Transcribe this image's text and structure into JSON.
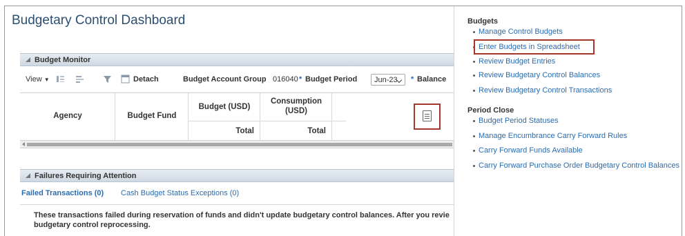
{
  "page": {
    "title": "Budgetary Control Dashboard"
  },
  "budget_monitor": {
    "header": "Budget Monitor",
    "toolbar": {
      "view_label": "View",
      "detach_label": "Detach",
      "budget_account_group_label": "Budget Account Group",
      "budget_account_group_value": "016040",
      "budget_period_label": "Budget Period",
      "budget_period_value": "Jun-23",
      "balance_label": "Balance",
      "required_marker": "*"
    },
    "columns": {
      "agency": "Agency",
      "budget_fund": "Budget Fund",
      "budget_usd": "Budget (USD)",
      "consumption_usd_line1": "Consumption",
      "consumption_usd_line2": "(USD)",
      "total_1": "Total",
      "total_2": "Total"
    }
  },
  "failures": {
    "header": "Failures Requiring Attention",
    "tabs": [
      "Failed Transactions (0)",
      "Cash Budget Status Exceptions (0)"
    ],
    "message_line1": "These transactions failed during reservation of funds and didn't update budgetary control balances. After you revie",
    "message_line2": "budgetary control reprocessing."
  },
  "tasks": {
    "budgets_title": "Budgets",
    "budgets_links": [
      "Manage Control Budgets",
      "Enter Budgets in Spreadsheet",
      "Review Budget Entries",
      "Review Budgetary Control Balances",
      "Review Budgetary Control Transactions"
    ],
    "period_close_title": "Period Close",
    "period_close_links": [
      "Budget Period Statuses",
      "Manage Encumbrance Carry Forward Rules",
      "Carry Forward Funds Available",
      "Carry Forward Purchase Order Budgetary Control Balances"
    ]
  },
  "colors": {
    "link": "#2a6cb0",
    "highlight_border": "#a5362b",
    "title": "#2b4f73"
  }
}
